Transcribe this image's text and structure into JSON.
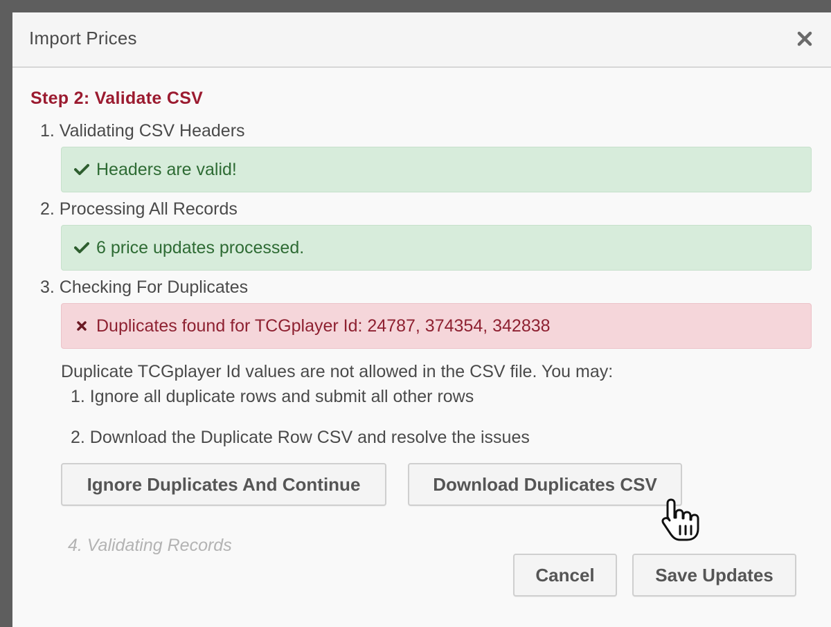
{
  "dialog": {
    "title": "Import Prices",
    "close_icon": "close-icon"
  },
  "step": {
    "title": "Step 2: Validate CSV"
  },
  "checks": [
    {
      "label": "1. Validating CSV Headers",
      "status": "success",
      "message": "Headers are valid!",
      "icon": "check-icon"
    },
    {
      "label": "2. Processing All Records",
      "status": "success",
      "message": "6 price updates processed.",
      "icon": "check-icon"
    },
    {
      "label": "3. Checking For Duplicates",
      "status": "error",
      "message": "Duplicates found for TCGplayer Id: 24787, 374354, 342838",
      "icon": "x-icon"
    }
  ],
  "duplicates": {
    "info": "Duplicate TCGplayer Id values are not allowed in the CSV file. You may:",
    "options": [
      "1. Ignore all duplicate rows and submit all other rows",
      "2. Download the Duplicate Row CSV and resolve the issues"
    ],
    "ignore_button": "Ignore Duplicates And Continue",
    "download_button": "Download Duplicates CSV"
  },
  "pending_step": "4. Validating Records",
  "footer": {
    "cancel_label": "Cancel",
    "save_label": "Save Updates"
  },
  "colors": {
    "step_title": "#9b1b30",
    "success_bg": "#d7ecdb",
    "success_text": "#2e6b34",
    "error_bg": "#f5d6da",
    "error_text": "#8e2131"
  }
}
